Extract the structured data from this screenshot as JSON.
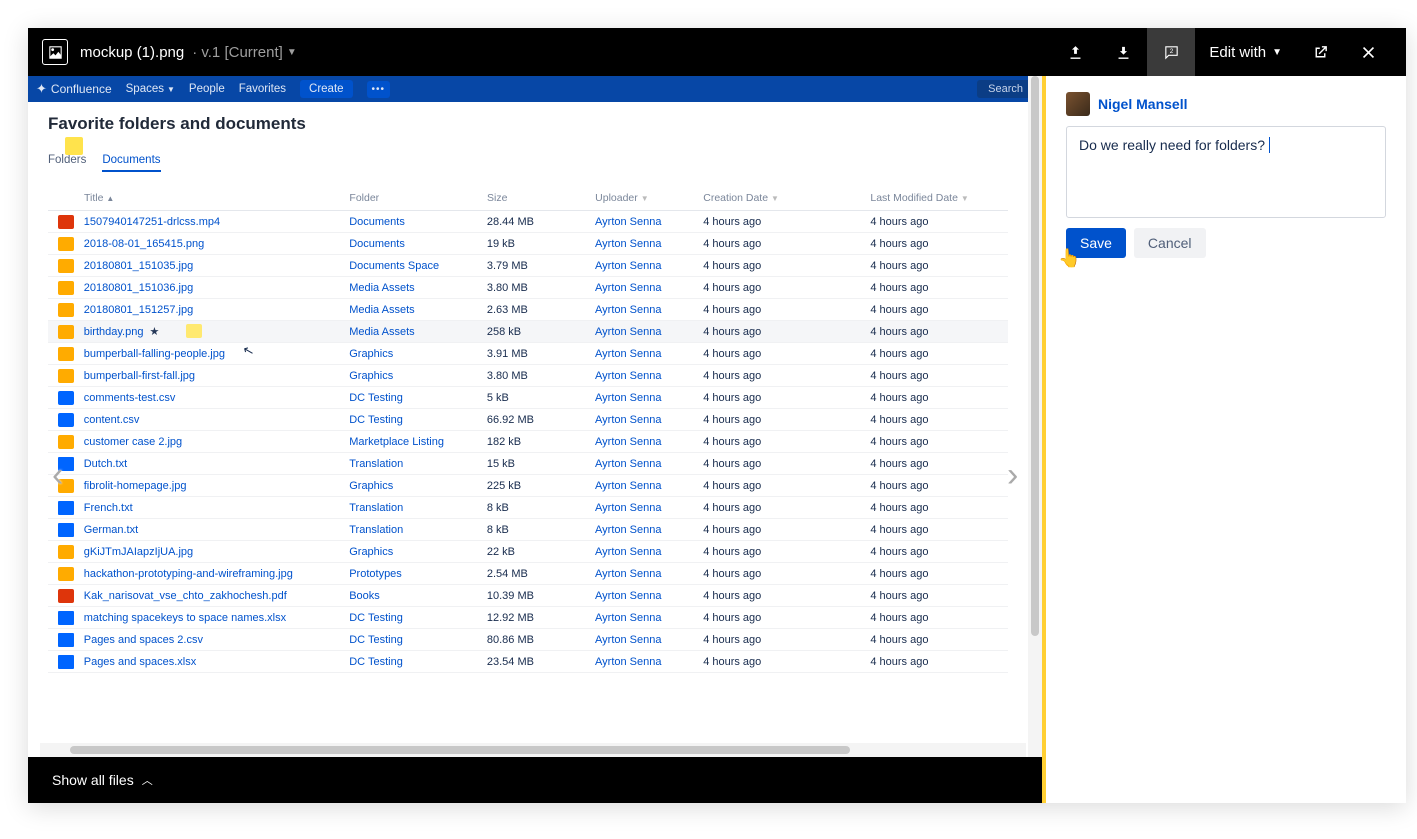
{
  "topbar": {
    "file_name": "mockup (1).png",
    "version_prefix": "· v.1",
    "version_label": "[Current]",
    "edit_with": "Edit with"
  },
  "nav_arrows": {
    "left": "‹",
    "right": "›"
  },
  "confluence": {
    "brand": "Confluence",
    "nav": {
      "spaces": "Spaces",
      "people": "People",
      "favorites": "Favorites",
      "create": "Create",
      "search": "Search"
    },
    "page_title": "Favorite folders and documents",
    "tabs": {
      "folders": "Folders",
      "documents": "Documents"
    },
    "columns": {
      "title": "Title",
      "folder": "Folder",
      "size": "Size",
      "uploader": "Uploader",
      "created": "Creation Date",
      "modified": "Last Modified Date"
    },
    "rows": [
      {
        "icon": "vid",
        "title": "1507940147251-drlcss.mp4",
        "folder": "Documents",
        "size": "28.44 MB",
        "uploader": "Ayrton Senna",
        "created": "4 hours ago",
        "modified": "4 hours ago"
      },
      {
        "icon": "img",
        "title": "2018-08-01_165415.png",
        "folder": "Documents",
        "size": "19 kB",
        "uploader": "Ayrton Senna",
        "created": "4 hours ago",
        "modified": "4 hours ago"
      },
      {
        "icon": "img",
        "title": "20180801_151035.jpg",
        "folder": "Documents Space",
        "size": "3.79 MB",
        "uploader": "Ayrton Senna",
        "created": "4 hours ago",
        "modified": "4 hours ago"
      },
      {
        "icon": "img",
        "title": "20180801_151036.jpg",
        "folder": "Media Assets",
        "size": "3.80 MB",
        "uploader": "Ayrton Senna",
        "created": "4 hours ago",
        "modified": "4 hours ago"
      },
      {
        "icon": "img",
        "title": "20180801_151257.jpg",
        "folder": "Media Assets",
        "size": "2.63 MB",
        "uploader": "Ayrton Senna",
        "created": "4 hours ago",
        "modified": "4 hours ago"
      },
      {
        "icon": "img",
        "title": "birthday.png",
        "folder": "Media Assets",
        "size": "258 kB",
        "uploader": "Ayrton Senna",
        "created": "4 hours ago",
        "modified": "4 hours ago",
        "starred": true,
        "hover": true
      },
      {
        "icon": "img",
        "title": "bumperball-falling-people.jpg",
        "folder": "Graphics",
        "size": "3.91 MB",
        "uploader": "Ayrton Senna",
        "created": "4 hours ago",
        "modified": "4 hours ago"
      },
      {
        "icon": "img",
        "title": "bumperball-first-fall.jpg",
        "folder": "Graphics",
        "size": "3.80 MB",
        "uploader": "Ayrton Senna",
        "created": "4 hours ago",
        "modified": "4 hours ago"
      },
      {
        "icon": "csv",
        "title": "comments-test.csv",
        "folder": "DC Testing",
        "size": "5 kB",
        "uploader": "Ayrton Senna",
        "created": "4 hours ago",
        "modified": "4 hours ago"
      },
      {
        "icon": "csv",
        "title": "content.csv",
        "folder": "DC Testing",
        "size": "66.92 MB",
        "uploader": "Ayrton Senna",
        "created": "4 hours ago",
        "modified": "4 hours ago"
      },
      {
        "icon": "img",
        "title": "customer case 2.jpg",
        "folder": "Marketplace Listing",
        "size": "182 kB",
        "uploader": "Ayrton Senna",
        "created": "4 hours ago",
        "modified": "4 hours ago"
      },
      {
        "icon": "doc",
        "title": "Dutch.txt",
        "folder": "Translation",
        "size": "15 kB",
        "uploader": "Ayrton Senna",
        "created": "4 hours ago",
        "modified": "4 hours ago"
      },
      {
        "icon": "img",
        "title": "fibrolit-homepage.jpg",
        "folder": "Graphics",
        "size": "225 kB",
        "uploader": "Ayrton Senna",
        "created": "4 hours ago",
        "modified": "4 hours ago"
      },
      {
        "icon": "doc",
        "title": "French.txt",
        "folder": "Translation",
        "size": "8 kB",
        "uploader": "Ayrton Senna",
        "created": "4 hours ago",
        "modified": "4 hours ago"
      },
      {
        "icon": "doc",
        "title": "German.txt",
        "folder": "Translation",
        "size": "8 kB",
        "uploader": "Ayrton Senna",
        "created": "4 hours ago",
        "modified": "4 hours ago"
      },
      {
        "icon": "img",
        "title": "gKiJTmJAIapzIjUA.jpg",
        "folder": "Graphics",
        "size": "22 kB",
        "uploader": "Ayrton Senna",
        "created": "4 hours ago",
        "modified": "4 hours ago"
      },
      {
        "icon": "img",
        "title": "hackathon-prototyping-and-wireframing.jpg",
        "folder": "Prototypes",
        "size": "2.54 MB",
        "uploader": "Ayrton Senna",
        "created": "4 hours ago",
        "modified": "4 hours ago"
      },
      {
        "icon": "pdf",
        "title": "Kak_narisovat_vse_chto_zakhochesh.pdf",
        "folder": "Books",
        "size": "10.39 MB",
        "uploader": "Ayrton Senna",
        "created": "4 hours ago",
        "modified": "4 hours ago"
      },
      {
        "icon": "doc",
        "title": "matching spacekeys to space names.xlsx",
        "folder": "DC Testing",
        "size": "12.92 MB",
        "uploader": "Ayrton Senna",
        "created": "4 hours ago",
        "modified": "4 hours ago"
      },
      {
        "icon": "doc",
        "title": "Pages and spaces 2.csv",
        "folder": "DC Testing",
        "size": "80.86 MB",
        "uploader": "Ayrton Senna",
        "created": "4 hours ago",
        "modified": "4 hours ago"
      },
      {
        "icon": "doc",
        "title": "Pages and spaces.xlsx",
        "folder": "DC Testing",
        "size": "23.54 MB",
        "uploader": "Ayrton Senna",
        "created": "4 hours ago",
        "modified": "4 hours ago"
      }
    ]
  },
  "show_all": "Show all files",
  "comment": {
    "author": "Nigel Mansell",
    "text": "Do we really need for folders?",
    "save": "Save",
    "cancel": "Cancel"
  }
}
